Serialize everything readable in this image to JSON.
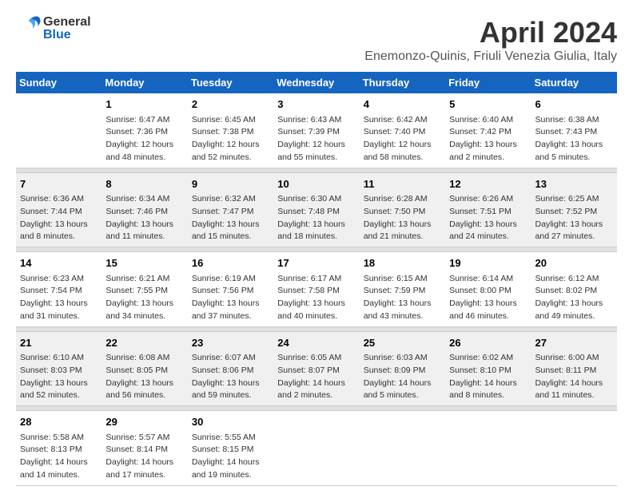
{
  "header": {
    "logo_general": "General",
    "logo_blue": "Blue",
    "month_title": "April 2024",
    "location": "Enemonzo-Quinis, Friuli Venezia Giulia, Italy"
  },
  "days_of_week": [
    "Sunday",
    "Monday",
    "Tuesday",
    "Wednesday",
    "Thursday",
    "Friday",
    "Saturday"
  ],
  "weeks": [
    [
      {
        "day": "",
        "sunrise": "",
        "sunset": "",
        "daylight": ""
      },
      {
        "day": "1",
        "sunrise": "Sunrise: 6:47 AM",
        "sunset": "Sunset: 7:36 PM",
        "daylight": "Daylight: 12 hours and 48 minutes."
      },
      {
        "day": "2",
        "sunrise": "Sunrise: 6:45 AM",
        "sunset": "Sunset: 7:38 PM",
        "daylight": "Daylight: 12 hours and 52 minutes."
      },
      {
        "day": "3",
        "sunrise": "Sunrise: 6:43 AM",
        "sunset": "Sunset: 7:39 PM",
        "daylight": "Daylight: 12 hours and 55 minutes."
      },
      {
        "day": "4",
        "sunrise": "Sunrise: 6:42 AM",
        "sunset": "Sunset: 7:40 PM",
        "daylight": "Daylight: 12 hours and 58 minutes."
      },
      {
        "day": "5",
        "sunrise": "Sunrise: 6:40 AM",
        "sunset": "Sunset: 7:42 PM",
        "daylight": "Daylight: 13 hours and 2 minutes."
      },
      {
        "day": "6",
        "sunrise": "Sunrise: 6:38 AM",
        "sunset": "Sunset: 7:43 PM",
        "daylight": "Daylight: 13 hours and 5 minutes."
      }
    ],
    [
      {
        "day": "7",
        "sunrise": "Sunrise: 6:36 AM",
        "sunset": "Sunset: 7:44 PM",
        "daylight": "Daylight: 13 hours and 8 minutes."
      },
      {
        "day": "8",
        "sunrise": "Sunrise: 6:34 AM",
        "sunset": "Sunset: 7:46 PM",
        "daylight": "Daylight: 13 hours and 11 minutes."
      },
      {
        "day": "9",
        "sunrise": "Sunrise: 6:32 AM",
        "sunset": "Sunset: 7:47 PM",
        "daylight": "Daylight: 13 hours and 15 minutes."
      },
      {
        "day": "10",
        "sunrise": "Sunrise: 6:30 AM",
        "sunset": "Sunset: 7:48 PM",
        "daylight": "Daylight: 13 hours and 18 minutes."
      },
      {
        "day": "11",
        "sunrise": "Sunrise: 6:28 AM",
        "sunset": "Sunset: 7:50 PM",
        "daylight": "Daylight: 13 hours and 21 minutes."
      },
      {
        "day": "12",
        "sunrise": "Sunrise: 6:26 AM",
        "sunset": "Sunset: 7:51 PM",
        "daylight": "Daylight: 13 hours and 24 minutes."
      },
      {
        "day": "13",
        "sunrise": "Sunrise: 6:25 AM",
        "sunset": "Sunset: 7:52 PM",
        "daylight": "Daylight: 13 hours and 27 minutes."
      }
    ],
    [
      {
        "day": "14",
        "sunrise": "Sunrise: 6:23 AM",
        "sunset": "Sunset: 7:54 PM",
        "daylight": "Daylight: 13 hours and 31 minutes."
      },
      {
        "day": "15",
        "sunrise": "Sunrise: 6:21 AM",
        "sunset": "Sunset: 7:55 PM",
        "daylight": "Daylight: 13 hours and 34 minutes."
      },
      {
        "day": "16",
        "sunrise": "Sunrise: 6:19 AM",
        "sunset": "Sunset: 7:56 PM",
        "daylight": "Daylight: 13 hours and 37 minutes."
      },
      {
        "day": "17",
        "sunrise": "Sunrise: 6:17 AM",
        "sunset": "Sunset: 7:58 PM",
        "daylight": "Daylight: 13 hours and 40 minutes."
      },
      {
        "day": "18",
        "sunrise": "Sunrise: 6:15 AM",
        "sunset": "Sunset: 7:59 PM",
        "daylight": "Daylight: 13 hours and 43 minutes."
      },
      {
        "day": "19",
        "sunrise": "Sunrise: 6:14 AM",
        "sunset": "Sunset: 8:00 PM",
        "daylight": "Daylight: 13 hours and 46 minutes."
      },
      {
        "day": "20",
        "sunrise": "Sunrise: 6:12 AM",
        "sunset": "Sunset: 8:02 PM",
        "daylight": "Daylight: 13 hours and 49 minutes."
      }
    ],
    [
      {
        "day": "21",
        "sunrise": "Sunrise: 6:10 AM",
        "sunset": "Sunset: 8:03 PM",
        "daylight": "Daylight: 13 hours and 52 minutes."
      },
      {
        "day": "22",
        "sunrise": "Sunrise: 6:08 AM",
        "sunset": "Sunset: 8:05 PM",
        "daylight": "Daylight: 13 hours and 56 minutes."
      },
      {
        "day": "23",
        "sunrise": "Sunrise: 6:07 AM",
        "sunset": "Sunset: 8:06 PM",
        "daylight": "Daylight: 13 hours and 59 minutes."
      },
      {
        "day": "24",
        "sunrise": "Sunrise: 6:05 AM",
        "sunset": "Sunset: 8:07 PM",
        "daylight": "Daylight: 14 hours and 2 minutes."
      },
      {
        "day": "25",
        "sunrise": "Sunrise: 6:03 AM",
        "sunset": "Sunset: 8:09 PM",
        "daylight": "Daylight: 14 hours and 5 minutes."
      },
      {
        "day": "26",
        "sunrise": "Sunrise: 6:02 AM",
        "sunset": "Sunset: 8:10 PM",
        "daylight": "Daylight: 14 hours and 8 minutes."
      },
      {
        "day": "27",
        "sunrise": "Sunrise: 6:00 AM",
        "sunset": "Sunset: 8:11 PM",
        "daylight": "Daylight: 14 hours and 11 minutes."
      }
    ],
    [
      {
        "day": "28",
        "sunrise": "Sunrise: 5:58 AM",
        "sunset": "Sunset: 8:13 PM",
        "daylight": "Daylight: 14 hours and 14 minutes."
      },
      {
        "day": "29",
        "sunrise": "Sunrise: 5:57 AM",
        "sunset": "Sunset: 8:14 PM",
        "daylight": "Daylight: 14 hours and 17 minutes."
      },
      {
        "day": "30",
        "sunrise": "Sunrise: 5:55 AM",
        "sunset": "Sunset: 8:15 PM",
        "daylight": "Daylight: 14 hours and 19 minutes."
      },
      {
        "day": "",
        "sunrise": "",
        "sunset": "",
        "daylight": ""
      },
      {
        "day": "",
        "sunrise": "",
        "sunset": "",
        "daylight": ""
      },
      {
        "day": "",
        "sunrise": "",
        "sunset": "",
        "daylight": ""
      },
      {
        "day": "",
        "sunrise": "",
        "sunset": "",
        "daylight": ""
      }
    ]
  ]
}
